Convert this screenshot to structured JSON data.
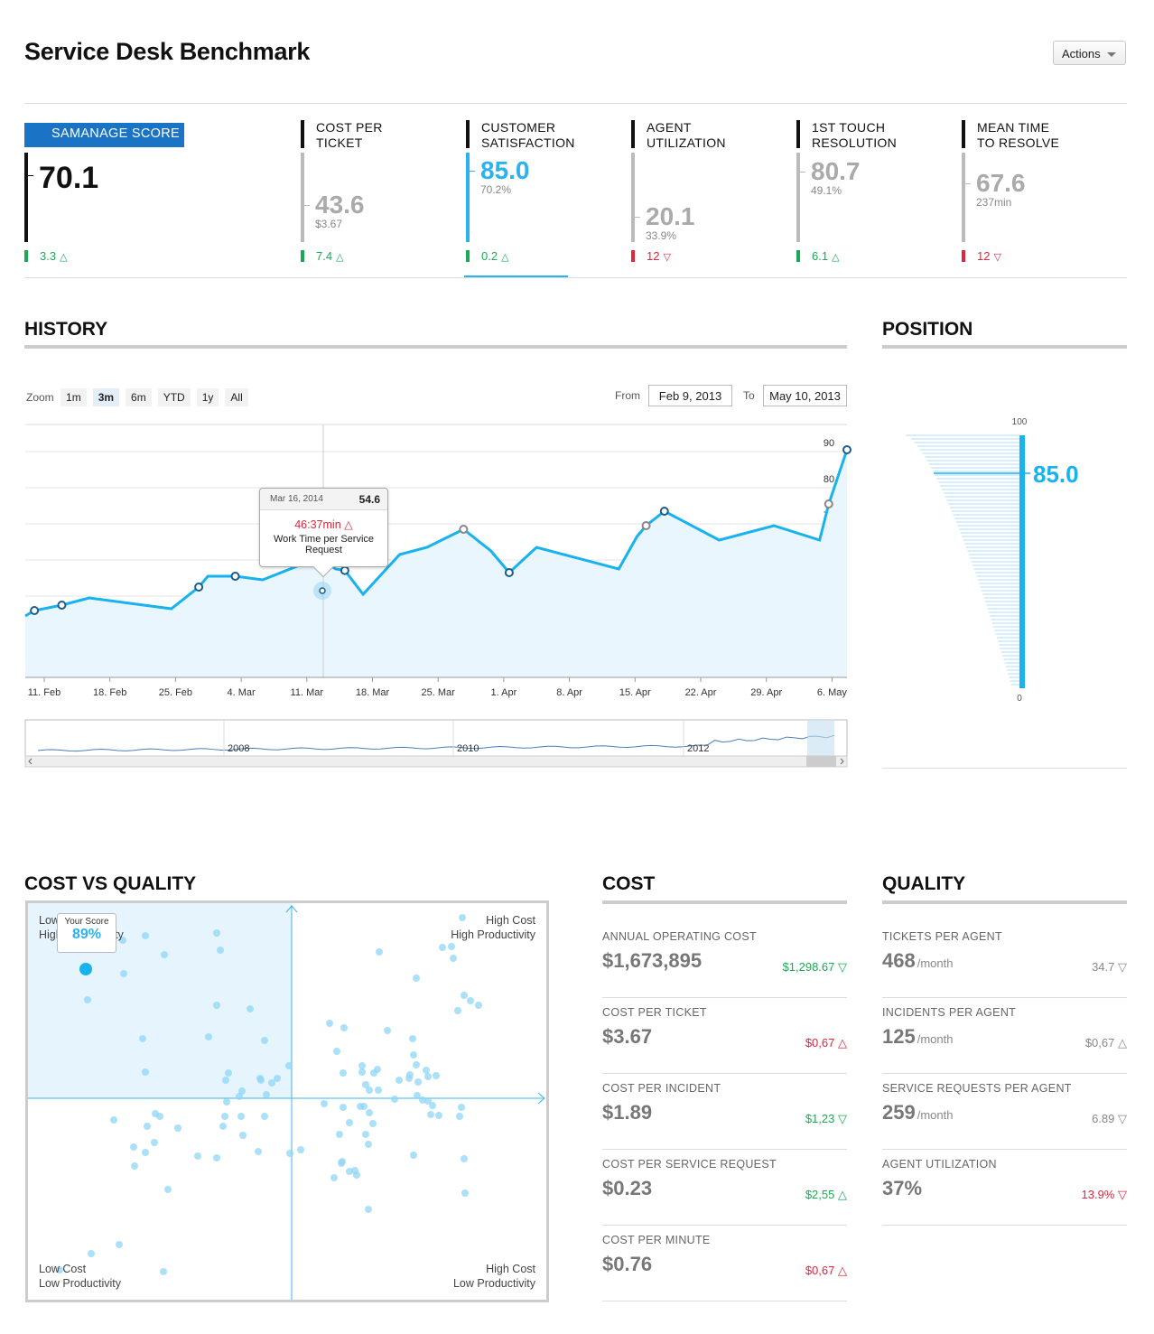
{
  "header": {
    "title": "Service Desk Benchmark",
    "actions_label": "Actions"
  },
  "kpis": [
    {
      "label": "SAMANAGE SCORE",
      "value": "70.1",
      "sub": "",
      "change": "3.3",
      "dir": "up",
      "color": "#1aaa55",
      "level": 0.7
    },
    {
      "label": "COST PER TICKET",
      "value": "43.6",
      "sub": "$3.67",
      "change": "7.4",
      "dir": "up",
      "color": "#1aaa55",
      "level": 0.436
    },
    {
      "label": "CUSTOMER SATISFACTION",
      "value": "85.0",
      "sub": "70.2%",
      "change": "0.2",
      "dir": "up",
      "color": "#1aaa55",
      "level": 0.85
    },
    {
      "label": "AGENT UTILIZATION",
      "value": "20.1",
      "sub": "33.9%",
      "change": "12",
      "dir": "down",
      "color": "#e0253c",
      "level": 0.201
    },
    {
      "label": "1ST TOUCH RESOLUTION",
      "value": "80.7",
      "sub": "49.1%",
      "change": "6.1",
      "dir": "up",
      "color": "#1aaa55",
      "level": 0.807
    },
    {
      "label": "MEAN TIME TO RESOLVE",
      "value": "67.6",
      "sub": "237min",
      "change": "12",
      "dir": "down",
      "color": "#e0253c",
      "level": 0.676
    }
  ],
  "history": {
    "title": "HISTORY",
    "zoom_label": "Zoom",
    "zoom_options": [
      "1m",
      "3m",
      "6m",
      "YTD",
      "1y",
      "All"
    ],
    "zoom_active": "3m",
    "from_label": "From",
    "from_value": "Feb 9, 2013",
    "to_label": "To",
    "to_value": "May 10, 2013",
    "tooltip": {
      "date": "Mar 16, 2014",
      "value": "54.6",
      "time": "46:37min",
      "desc1": "Work Time per Service",
      "desc2": "Request"
    },
    "navigator_years": [
      "2008",
      "2010",
      "2012"
    ]
  },
  "chart_data": {
    "type": "line",
    "x": [
      "Feb 9",
      "Feb 10",
      "Feb 13",
      "Feb 16",
      "Feb 25",
      "Feb 28",
      "Mar 1",
      "Mar 4",
      "Mar 7",
      "Mar 13",
      "Mar 15",
      "Mar 16",
      "Mar 18",
      "Mar 22",
      "Mar 25",
      "Mar 29",
      "Apr 1",
      "Apr 3",
      "Apr 6",
      "Apr 15",
      "Apr 17",
      "Apr 18",
      "Apr 20",
      "Apr 26",
      "May 2",
      "May 7",
      "May 8",
      "May 10"
    ],
    "values": [
      42,
      43.5,
      45,
      47,
      44,
      50,
      53,
      53,
      52,
      58,
      55,
      54.6,
      48,
      59,
      61,
      66,
      60,
      54,
      61,
      55,
      64,
      67,
      71,
      63,
      67,
      63,
      73,
      88
    ],
    "xticks": [
      "11. Feb",
      "18. Feb",
      "25. Feb",
      "4. Mar",
      "11. Mar",
      "18. Mar",
      "25. Mar",
      "1. Apr",
      "8. Apr",
      "15. Apr",
      "22. Apr",
      "29. Apr",
      "6. May"
    ],
    "yticks": [
      "30",
      "40",
      "50",
      "60",
      "70",
      "80",
      "90"
    ],
    "ylim": [
      25,
      95
    ],
    "grid": true
  },
  "position": {
    "title": "POSITION",
    "max": "100",
    "min": "0",
    "value": "85.0",
    "level": 0.85
  },
  "cost_vs_quality": {
    "title": "COST VS QUALITY",
    "q_tl1": "Low Cost",
    "q_tl2": "High Productivity",
    "q_tr1": "High Cost",
    "q_tr2": "High Productivity",
    "q_bl1": "Low Cost",
    "q_bl2": "Low Productivity",
    "q_br1": "High Cost",
    "q_br2": "Low Productivity",
    "your_score_label": "Your Score",
    "your_score": "89%"
  },
  "cost": {
    "title": "COST",
    "rows": [
      {
        "label": "ANNUAL OPERATING COST",
        "value": "$1,673,895",
        "change": "$1,298.67",
        "dir": "down",
        "cls": "green"
      },
      {
        "label": "COST PER TICKET",
        "value": "$3.67",
        "change": "$0,67",
        "dir": "up",
        "cls": "red"
      },
      {
        "label": "COST PER INCIDENT",
        "value": "$1.89",
        "change": "$1,23",
        "dir": "down",
        "cls": "green"
      },
      {
        "label": "COST PER SERVICE REQUEST",
        "value": "$0.23",
        "change": "$2,55",
        "dir": "up",
        "cls": "green"
      },
      {
        "label": "COST PER MINUTE",
        "value": "$0.76",
        "change": "$0,67",
        "dir": "up",
        "cls": "red"
      }
    ]
  },
  "quality": {
    "title": "QUALITY",
    "rows": [
      {
        "label": "TICKETS PER AGENT",
        "value": "468",
        "unit": "/month",
        "change": "34.7",
        "dir": "down",
        "cls": "grey"
      },
      {
        "label": "INCIDENTS PER AGENT",
        "value": "125",
        "unit": "/month",
        "change": "$0,67",
        "dir": "up",
        "cls": "grey"
      },
      {
        "label": "SERVICE REQUESTS PER AGENT",
        "value": "259",
        "unit": "/month",
        "change": "6.89",
        "dir": "down",
        "cls": "grey"
      },
      {
        "label": "AGENT UTILIZATION",
        "value": "37%",
        "unit": "",
        "change": "13.9%",
        "dir": "down",
        "cls": "red"
      }
    ]
  }
}
